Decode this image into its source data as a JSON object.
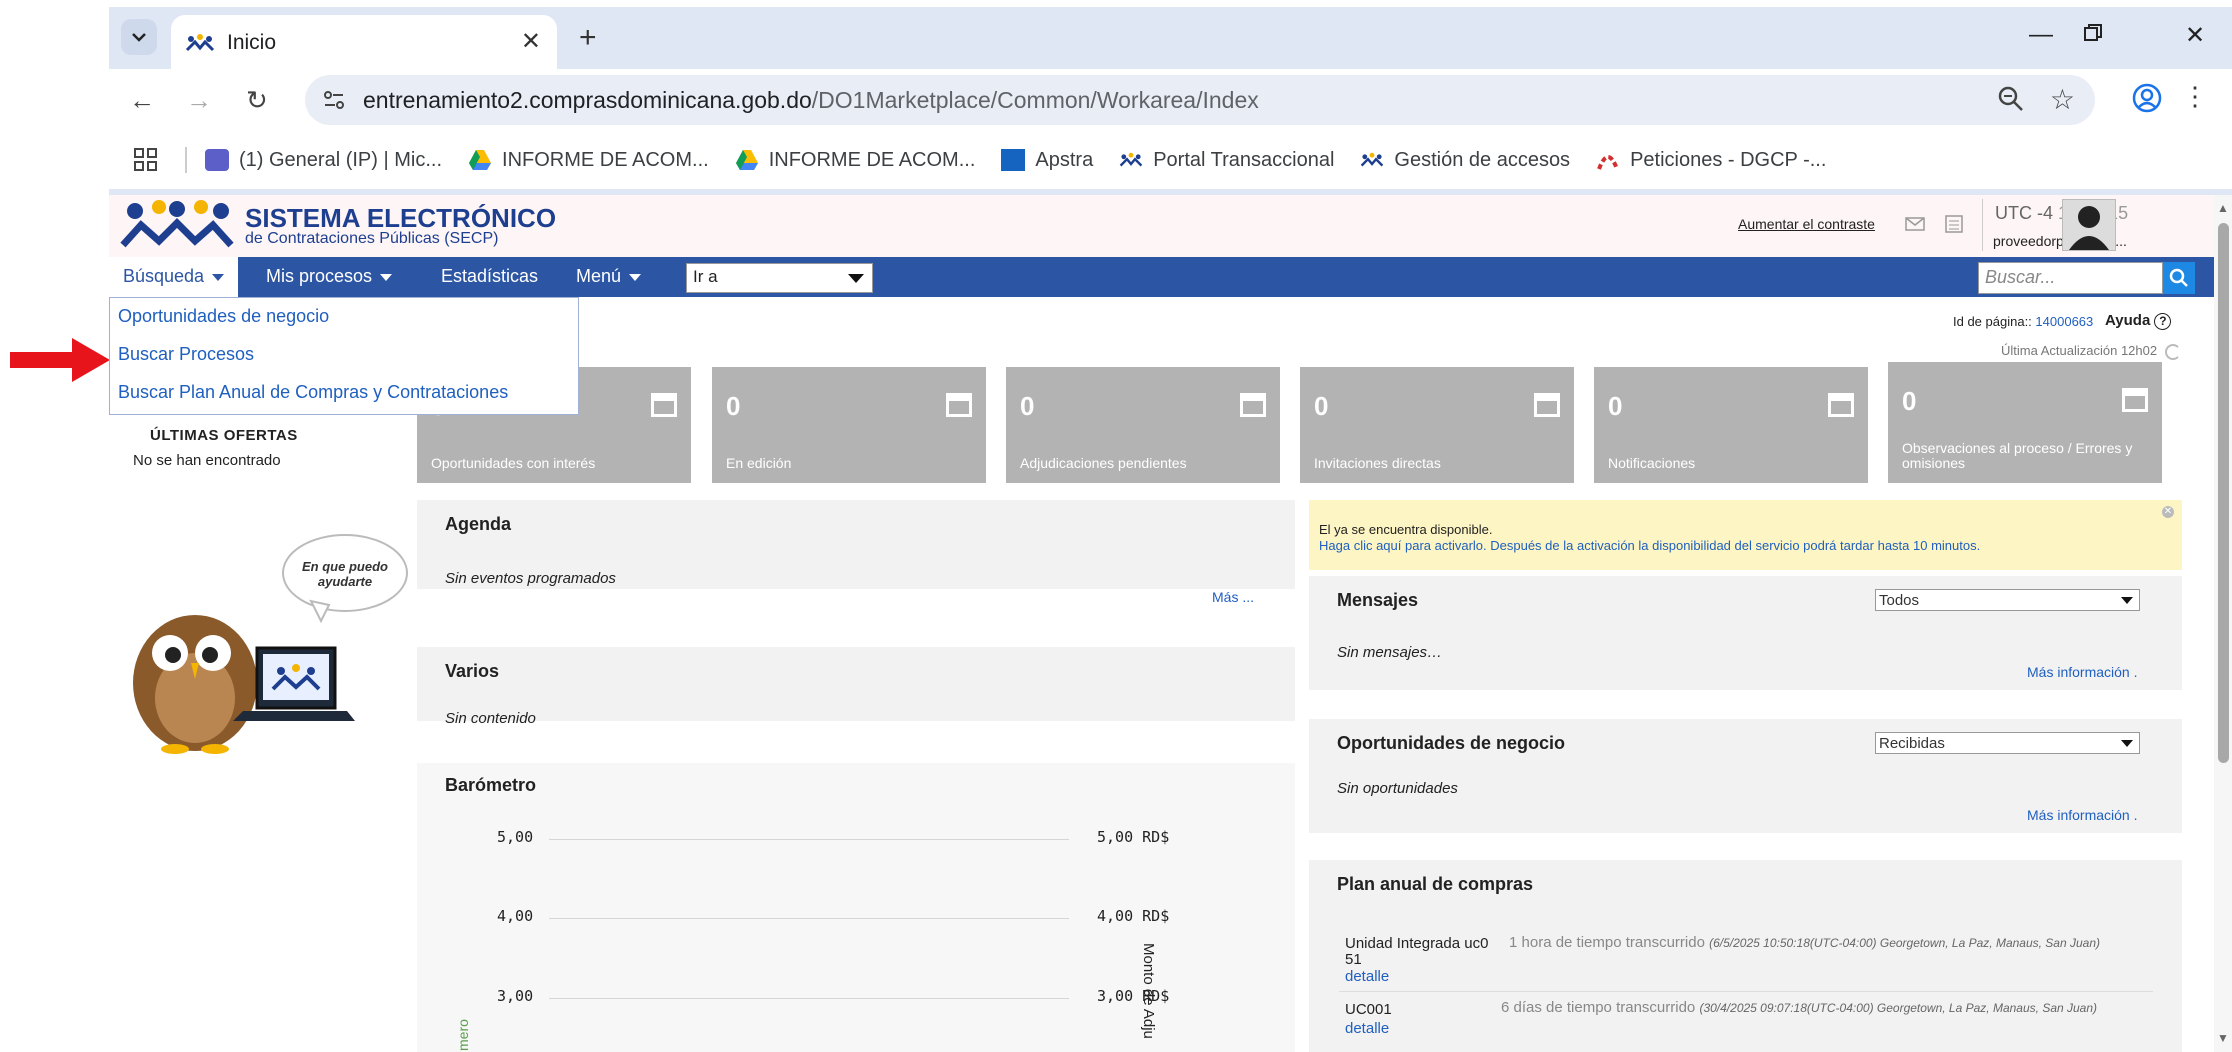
{
  "browser": {
    "tab_title": "Inicio",
    "url_host": "entrenamiento2.comprasdominicana.gob.do",
    "url_path": "/DO1Marketplace/Common/Workarea/Index",
    "bookmarks": [
      "(1) General (IP) | Mic...",
      "INFORME DE ACOM...",
      "INFORME DE ACOM...",
      "Apstra",
      "Portal Transaccional",
      "Gestión de accesos",
      "Peticiones - DGCP -..."
    ]
  },
  "header": {
    "title": "SISTEMA ELECTRÓNICO",
    "subtitle": "de Contrataciones Públicas (SECP)",
    "contrast_link": "Aumentar el contraste",
    "utc": "UTC -4",
    "clock": "12:03:15",
    "username": "proveedorprueba66..."
  },
  "nav": {
    "busqueda": "Búsqueda",
    "mis_procesos": "Mis procesos",
    "estadisticas": "Estadísticas",
    "menu": "Menú",
    "ira": "Ir a",
    "search_placeholder": "Buscar..."
  },
  "dropdown": {
    "items": [
      "Oportunidades de negocio",
      "Buscar Procesos",
      "Buscar Plan Anual de Compras y Contrataciones"
    ]
  },
  "page_meta": {
    "page_id_label": "Id de página::",
    "page_id": "14000663",
    "help": "Ayuda",
    "last_update": "Última Actualización 12h02"
  },
  "sidebar": {
    "ultimas_ofertas": "ÚLTIMAS OFERTAS",
    "no_encontrado": "No se han encontrado",
    "owl_bubble_1": "En que puedo",
    "owl_bubble_2": "ayudarte"
  },
  "tiles": [
    {
      "value": "0",
      "label": "Oportunidades con interés"
    },
    {
      "value": "0",
      "label": "En edición"
    },
    {
      "value": "0",
      "label": "Adjudicaciones pendientes"
    },
    {
      "value": "0",
      "label": "Invitaciones directas"
    },
    {
      "value": "0",
      "label": "Notificaciones"
    },
    {
      "value": "0",
      "label": "Observaciones al proceso / Errores y omisiones"
    }
  ],
  "agenda": {
    "title": "Agenda",
    "empty": "Sin eventos programados",
    "more": "Más ..."
  },
  "varios": {
    "title": "Varios",
    "empty": "Sin contenido"
  },
  "barometro": {
    "title": "Barómetro",
    "left_ticks": [
      "5,00",
      "4,00",
      "3,00"
    ],
    "right_ticks": [
      "5,00 RD$",
      "4,00 RD$",
      "3,00 RD$"
    ],
    "right_axis_label": "Monto de Adju",
    "left_axis_label": "mero"
  },
  "notice": {
    "line1": "El ya se encuentra disponible.",
    "line2": "Haga clic aquí para activarlo. Después de la activación la disponibilidad del servicio podrá tardar hasta 10 minutos."
  },
  "mensajes": {
    "title": "Mensajes",
    "filter": "Todos",
    "empty": "Sin mensajes…",
    "more": "Más información ."
  },
  "oportunidades": {
    "title": "Oportunidades de negocio",
    "filter": "Recibidas",
    "empty": "Sin oportunidades",
    "more": "Más información ."
  },
  "plan": {
    "title": "Plan anual de compras",
    "rows": [
      {
        "name": "Unidad Integrada uc0",
        "name2": "51",
        "elapsed": "1 hora de tiempo transcurrido",
        "date": "(6/5/2025 10:50:18(UTC-04:00) Georgetown, La Paz, Manaus, San Juan)",
        "link": "detalle"
      },
      {
        "name": "UC001",
        "name2": "",
        "elapsed": "6 días de tiempo transcurrido",
        "date": "(30/4/2025 09:07:18(UTC-04:00) Georgetown, La Paz, Manaus, San Juan)",
        "link": "detalle"
      }
    ]
  },
  "colors": {
    "nav_blue": "#2c56a3",
    "link_blue": "#1f5fbf",
    "tile_gray": "#b3b3b3",
    "arrow_red": "#e8141b"
  }
}
